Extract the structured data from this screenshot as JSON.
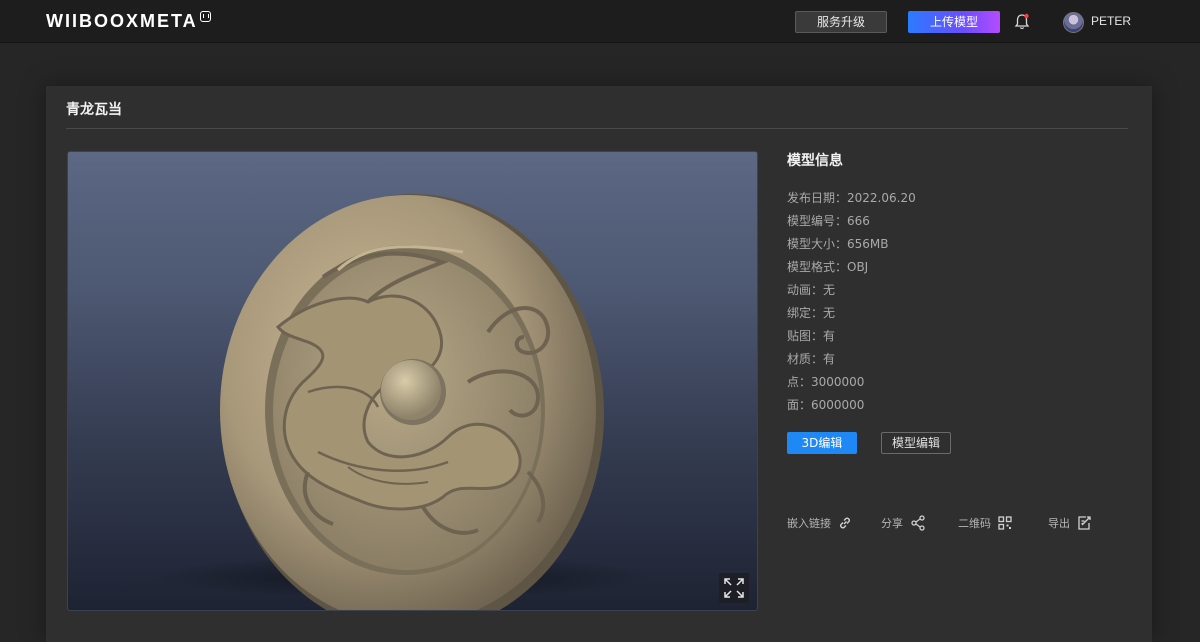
{
  "header": {
    "logo": "WIIBOOXMETA",
    "upgrade_label": "服务升级",
    "upload_label": "上传模型",
    "username": "PETER"
  },
  "page": {
    "title": "青龙瓦当"
  },
  "info": {
    "heading": "模型信息",
    "rows": [
      "发布日期：2022.06.20",
      "模型编号：666",
      "模型大小：656MB",
      "模型格式：OBJ",
      "动画：无",
      "绑定：无",
      "贴图：有",
      "材质：有",
      "点：3000000",
      "面：6000000"
    ],
    "edit_3d_label": "3D编辑",
    "model_edit_label": "模型编辑"
  },
  "actions": {
    "embed_label": "嵌入链接",
    "share_label": "分享",
    "qrcode_label": "二维码",
    "export_label": "导出"
  },
  "colors": {
    "accent_blue": "#1e88f5",
    "upload_gradient_start": "#2b7bff",
    "upload_gradient_end": "#b54bff",
    "notification_dot": "#ff3b3b"
  }
}
